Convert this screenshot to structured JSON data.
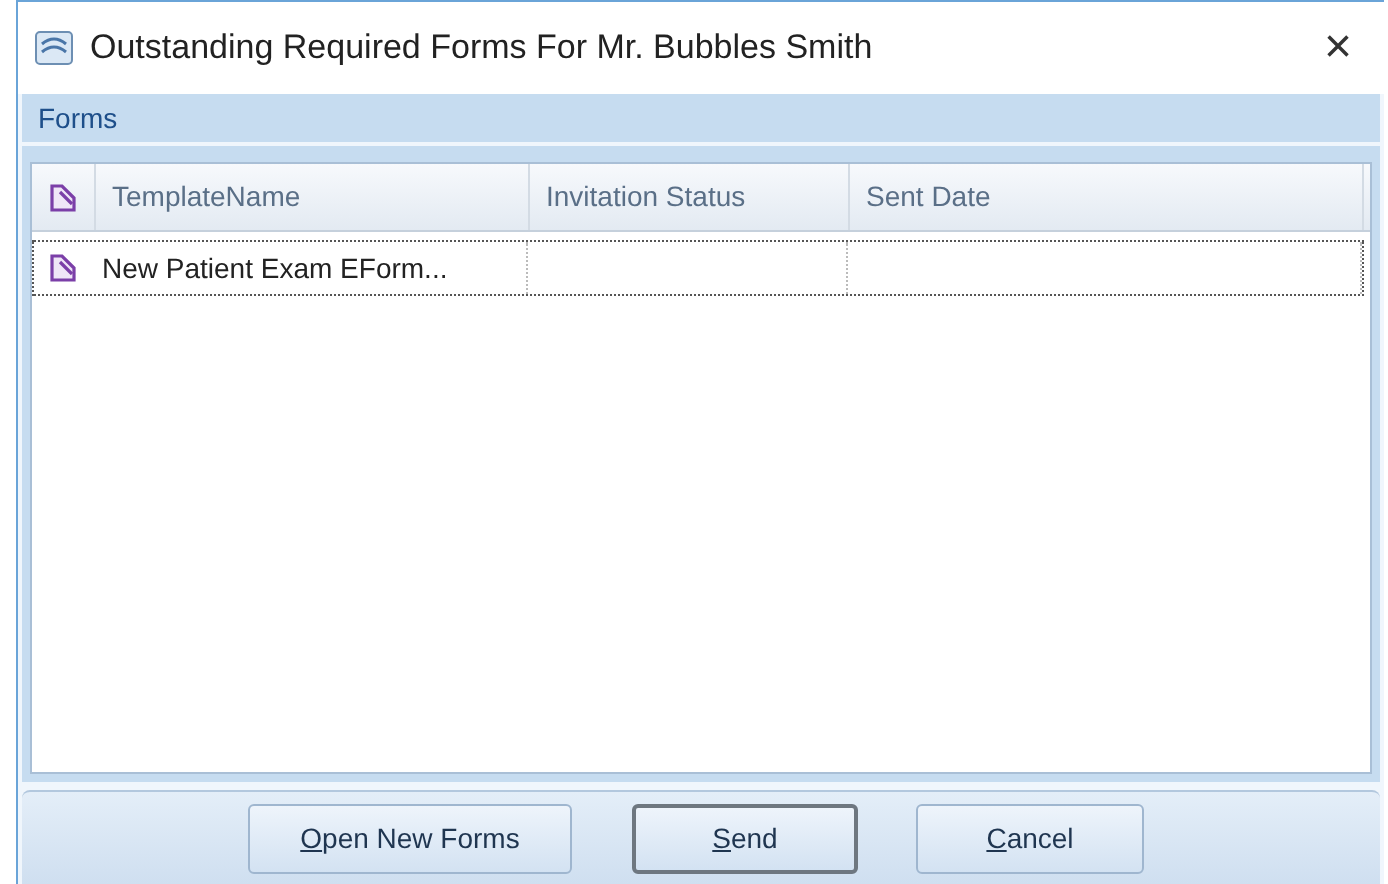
{
  "window": {
    "title": "Outstanding Required Forms For Mr. Bubbles Smith",
    "close": "×"
  },
  "panel": {
    "title": "Forms"
  },
  "table": {
    "columns": [
      {
        "label": "TemplateName"
      },
      {
        "label": "Invitation Status"
      },
      {
        "label": "Sent Date"
      }
    ],
    "rows": [
      {
        "selected": true,
        "cells": [
          "New Patient Exam EForm..."
        ]
      }
    ]
  },
  "buttons": [
    {
      "label": "Open New Forms",
      "underline_first": true,
      "default": false
    },
    {
      "label": "Send",
      "underline_first": true,
      "default": true
    },
    {
      "label": "Cancel",
      "underline_first": true,
      "default": false
    }
  ]
}
